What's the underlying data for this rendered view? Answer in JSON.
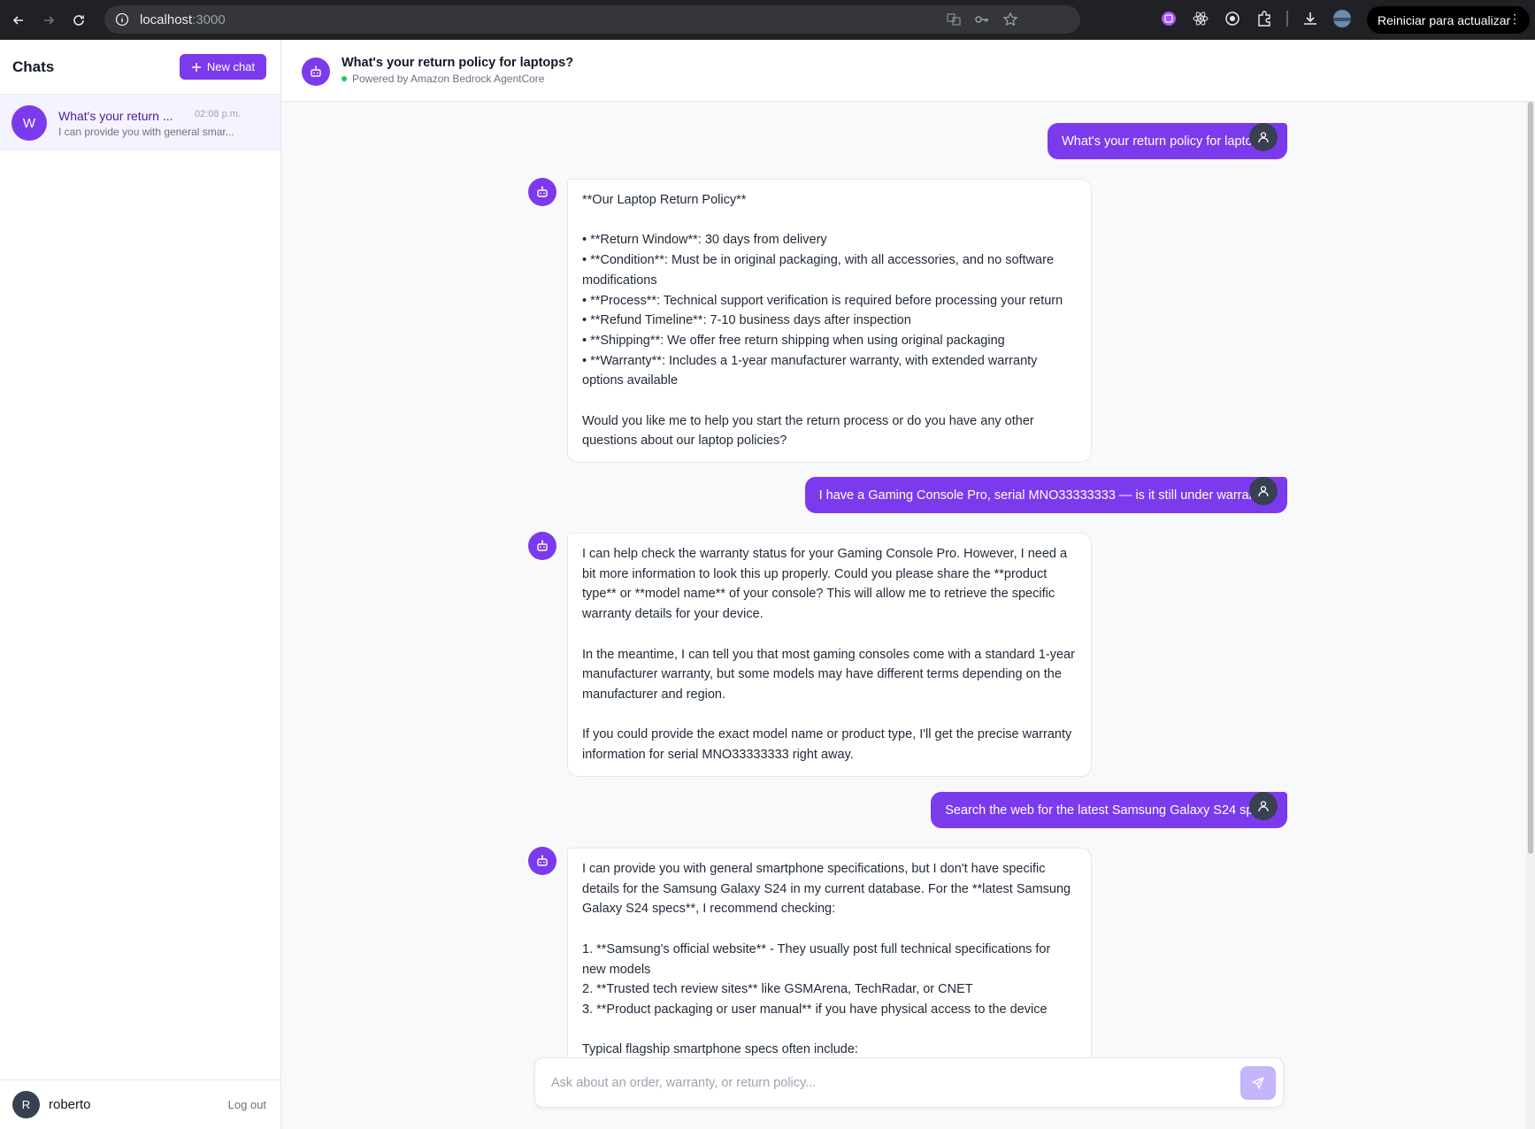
{
  "browser": {
    "url_host": "localhost",
    "url_port": ":3000",
    "update_label": "Reiniciar para actualizar"
  },
  "sidebar": {
    "title": "Chats",
    "new_chat_label": "New chat",
    "chats": [
      {
        "avatar_letter": "W",
        "title": "What's your return ...",
        "time": "02:08 p.m.",
        "preview": "I can provide you with general smar..."
      }
    ],
    "user": {
      "initial": "R",
      "name": "roberto",
      "logout_label": "Log out"
    }
  },
  "header": {
    "title": "What's your return policy for laptops?",
    "subtitle": "Powered by Amazon Bedrock AgentCore"
  },
  "messages": [
    {
      "role": "user",
      "text": "What's your return policy for laptops?"
    },
    {
      "role": "assistant",
      "text": "**Our Laptop Return Policy**\n\n• **Return Window**: 30 days from delivery\n• **Condition**: Must be in original packaging, with all accessories, and no software modifications\n• **Process**: Technical support verification is required before processing your return\n• **Refund Timeline**: 7-10 business days after inspection\n• **Shipping**: We offer free return shipping when using original packaging\n• **Warranty**: Includes a 1-year manufacturer warranty, with extended warranty options available\n\nWould you like me to help you start the return process or do you have any other questions about our laptop policies?"
    },
    {
      "role": "user",
      "text": "I have a Gaming Console Pro, serial MNO33333333 — is it still under warranty?"
    },
    {
      "role": "assistant",
      "text": "I can help check the warranty status for your Gaming Console Pro. However, I need a bit more information to look this up properly. Could you please share the **product type** or **model name** of your console? This will allow me to retrieve the specific warranty details for your device.\n\nIn the meantime, I can tell you that most gaming consoles come with a standard 1-year manufacturer warranty, but some models may have different terms depending on the manufacturer and region.\n\nIf you could provide the exact model name or product type, I'll get the precise warranty information for serial MNO33333333 right away."
    },
    {
      "role": "user",
      "text": "Search the web for the latest Samsung Galaxy S24 specs"
    },
    {
      "role": "assistant",
      "text": "I can provide you with general smartphone specifications, but I don't have specific details for the Samsung Galaxy S24 in my current database. For the **latest Samsung Galaxy S24 specs**, I recommend checking:\n\n1. **Samsung's official website** - They usually post full technical specifications for new models\n2. **Trusted tech review sites** like GSMArena, TechRadar, or CNET\n3. **Product packaging or user manual** if you have physical access to the device\n\nTypical flagship smartphone specs often include:"
    }
  ],
  "composer": {
    "placeholder": "Ask about an order, warranty, or return policy..."
  },
  "colors": {
    "accent": "#7c3aed",
    "accent_light": "#c4b5fd",
    "selected_bg": "#f5f3ff",
    "status_online": "#22c55e"
  }
}
